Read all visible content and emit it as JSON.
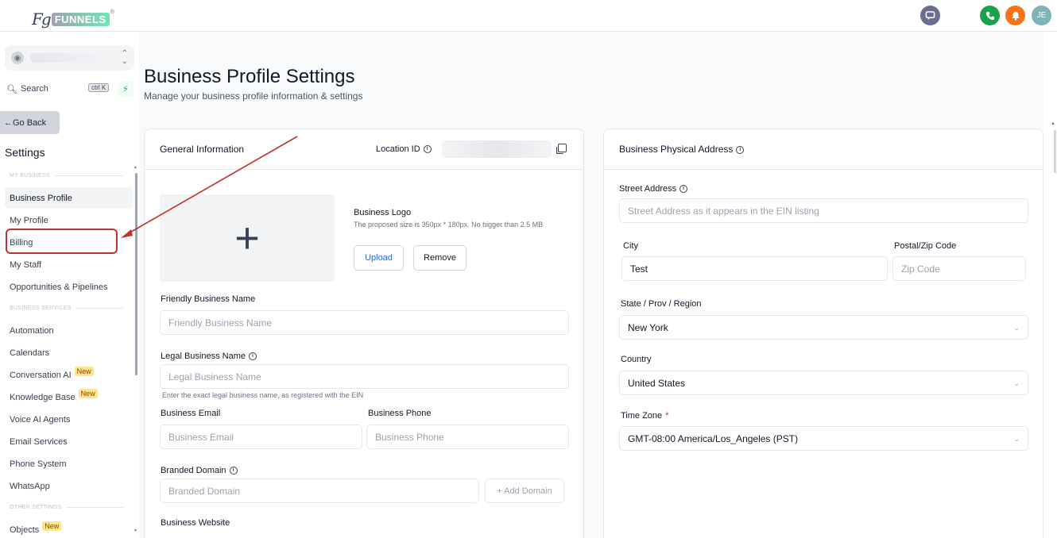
{
  "topbar": {
    "logo_prefix": "Fg",
    "logo_word": "FUNNELS",
    "logo_mark": "®",
    "avatar_initials": "JE",
    "icons": [
      "chat-icon",
      "phone-icon",
      "bell-icon"
    ]
  },
  "sidebar": {
    "search_label": "Search",
    "search_shortcut": "ctrl K",
    "go_back": "Go Back",
    "settings_title": "Settings",
    "sections": {
      "my_business": "MY BUSINESS",
      "business_services": "BUSINESS SERVICES",
      "other_settings": "OTHER SETTINGS"
    },
    "items": [
      {
        "label": "Business Profile",
        "active": true
      },
      {
        "label": "My Profile"
      },
      {
        "label": "Billing"
      },
      {
        "label": "My Staff"
      },
      {
        "label": "Opportunities & Pipelines"
      },
      {
        "label": "Automation"
      },
      {
        "label": "Calendars"
      },
      {
        "label": "Conversation AI",
        "badge": "New"
      },
      {
        "label": "Knowledge Base",
        "badge": "New"
      },
      {
        "label": "Voice AI Agents"
      },
      {
        "label": "Email Services"
      },
      {
        "label": "Phone System"
      },
      {
        "label": "WhatsApp"
      },
      {
        "label": "Objects",
        "badge": "New"
      }
    ]
  },
  "main": {
    "title": "Business Profile Settings",
    "subtitle": "Manage your business profile information & settings"
  },
  "general": {
    "title": "General Information",
    "location_id_label": "Location ID",
    "logo_plus": "+",
    "logo_label": "Business Logo",
    "logo_hint": "The proposed size is 350px * 180px. No bigger than 2.5 MB",
    "upload": "Upload",
    "remove": "Remove",
    "friendly_name_label": "Friendly Business Name",
    "friendly_name_placeholder": "Friendly Business Name",
    "legal_name_label": "Legal Business Name",
    "legal_name_placeholder": "Legal Business Name",
    "legal_name_hint": "Enter the exact legal business name, as registered with the EIN",
    "email_label": "Business Email",
    "email_placeholder": "Business Email",
    "phone_label": "Business Phone",
    "phone_placeholder": "Business Phone",
    "domain_label": "Branded Domain",
    "domain_placeholder": "Branded Domain",
    "add_domain": "+ Add Domain",
    "website_label": "Business Website"
  },
  "address": {
    "title": "Business Physical Address",
    "street_label": "Street Address",
    "street_placeholder": "Street Address as it appears in the EIN listing",
    "city_label": "City",
    "city_value": "Test",
    "zip_label": "Postal/Zip Code",
    "zip_placeholder": "Zip Code",
    "state_label": "State / Prov / Region",
    "state_value": "New York",
    "country_label": "Country",
    "country_value": "United States",
    "timezone_label": "Time Zone",
    "timezone_required": "*",
    "timezone_value": "GMT-08:00 America/Los_Angeles (PST)"
  },
  "colors": {
    "accent_blue": "#2563eb",
    "highlight_red": "#c53030",
    "badge_yellow": "#fde68a"
  }
}
